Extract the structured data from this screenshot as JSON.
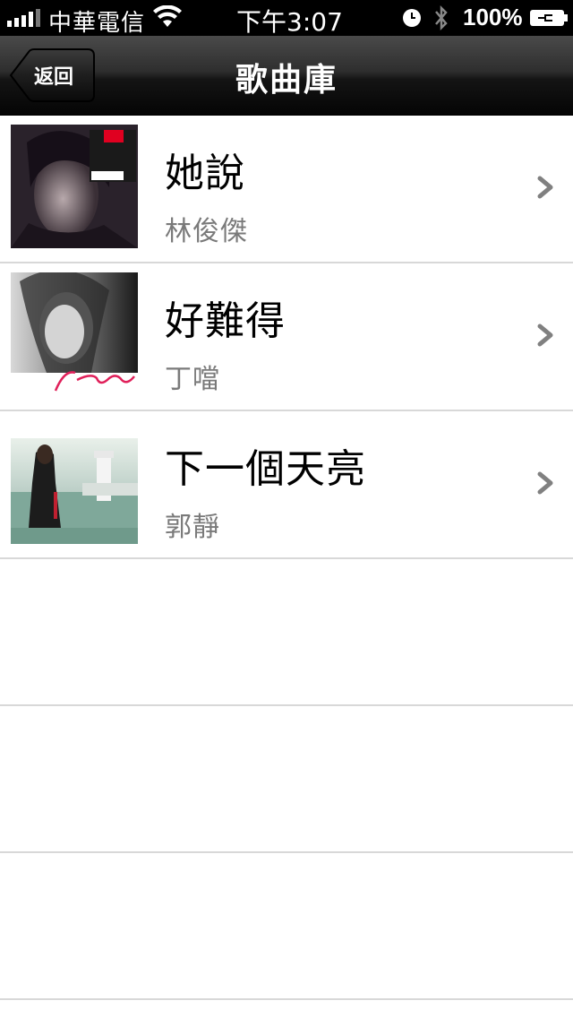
{
  "status_bar": {
    "carrier": "中華電信",
    "time": "下午3:07",
    "battery": "100%"
  },
  "nav": {
    "back_label": "返回",
    "title": "歌曲庫"
  },
  "songs": [
    {
      "title": "她說",
      "artist": "林俊傑"
    },
    {
      "title": "好難得",
      "artist": "丁噹"
    },
    {
      "title": "下一個天亮",
      "artist": "郭靜"
    }
  ],
  "colors": {
    "nav_bg": "#111111",
    "title_text": "#000000",
    "artist_text": "#7a7a7a",
    "separator": "#d8d8d8",
    "chevron": "#808080"
  },
  "icons": [
    "signal-icon",
    "wifi-icon",
    "clock-icon",
    "bluetooth-icon",
    "battery-icon",
    "chevron-right-icon"
  ]
}
